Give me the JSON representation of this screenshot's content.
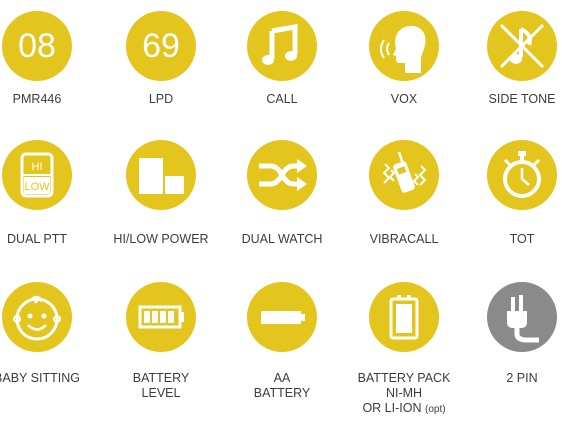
{
  "colors": {
    "accent": "#e4c51d",
    "neutral": "#8a8a8a",
    "text": "#3c3c3c"
  },
  "row1": [
    {
      "icon": "number-08-icon",
      "badge": "08",
      "label": "PMR446"
    },
    {
      "icon": "number-69-icon",
      "badge": "69",
      "label": "LPD"
    },
    {
      "icon": "music-note-icon",
      "label": "CALL"
    },
    {
      "icon": "voice-head-icon",
      "label": "VOX"
    },
    {
      "icon": "muted-note-icon",
      "label": "SIDE TONE"
    }
  ],
  "row2": [
    {
      "icon": "hi-low-switch-icon",
      "hi": "HI",
      "low": "LOW",
      "label": "DUAL PTT"
    },
    {
      "icon": "power-level-icon",
      "label": "HI/LOW POWER"
    },
    {
      "icon": "shuffle-arrows-icon",
      "label": "DUAL WATCH"
    },
    {
      "icon": "vibrating-radio-icon",
      "label": "VIBRACALL"
    },
    {
      "icon": "stopwatch-icon",
      "label": "TOT"
    }
  ],
  "row3": [
    {
      "icon": "baby-face-icon",
      "label": "BABY SITTING"
    },
    {
      "icon": "battery-level-icon",
      "label_line1": "BATTERY",
      "label_line2": "LEVEL"
    },
    {
      "icon": "aa-battery-icon",
      "label_line1": "AA",
      "label_line2": "BATTERY"
    },
    {
      "icon": "battery-pack-icon",
      "label_line1": "BATTERY PACK",
      "label_line2": "NI-MH",
      "label_line3": "OR LI-ION",
      "label_opt": "(opt)"
    },
    {
      "icon": "two-pin-plug-icon",
      "label": "2 PIN"
    }
  ]
}
